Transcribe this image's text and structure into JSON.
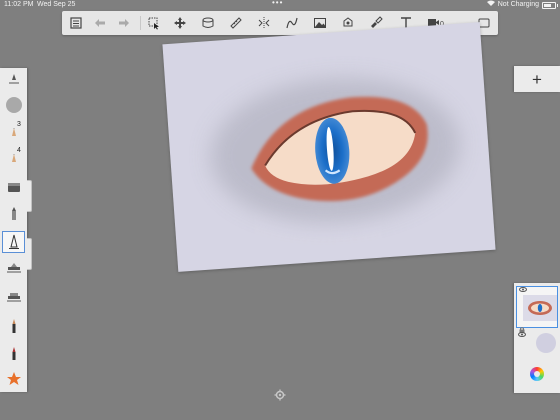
{
  "status_bar": {
    "time": "11:02 PM",
    "date": "Wed Sep 25",
    "dots": "•••",
    "battery_text": "Not Charging",
    "battery_level": 0.65
  },
  "toolbar": {
    "buttons": [
      {
        "name": "gallery-icon"
      },
      {
        "name": "undo-icon"
      },
      {
        "name": "redo-icon"
      },
      {
        "name": "select-icon"
      },
      {
        "name": "transform-icon"
      },
      {
        "name": "layers-icon"
      },
      {
        "name": "ruler-icon"
      },
      {
        "name": "symmetry-icon"
      },
      {
        "name": "curve-icon"
      },
      {
        "name": "image-icon"
      },
      {
        "name": "fill-icon"
      },
      {
        "name": "paint-style-icon"
      },
      {
        "name": "text-icon"
      },
      {
        "name": "video-icon"
      },
      {
        "name": "fullscreen-icon"
      }
    ]
  },
  "palette": {
    "tools": [
      {
        "name": "brush-size-icon",
        "num": ""
      },
      {
        "name": "brush-preview-icon",
        "num": ""
      },
      {
        "name": "pencil-icon",
        "num": "3"
      },
      {
        "name": "pencil-icon",
        "num": "4"
      },
      {
        "name": "eraser-icon",
        "num": ""
      },
      {
        "name": "marker-icon",
        "num": ""
      },
      {
        "name": "airbrush-icon",
        "num": ""
      },
      {
        "name": "smudge-icon",
        "num": ""
      },
      {
        "name": "flat-brush-icon",
        "num": ""
      },
      {
        "name": "paint-brush-icon",
        "num": ""
      },
      {
        "name": "ink-brush-icon",
        "num": ""
      },
      {
        "name": "favorite-star-icon",
        "num": ""
      }
    ]
  },
  "layers": {
    "add_label": "+"
  },
  "colors": {
    "background": "#7f7f7f",
    "panel": "#ebebeb",
    "canvas": "#d6d5e4",
    "accent": "#4a90e2",
    "star": "#e8702a"
  }
}
